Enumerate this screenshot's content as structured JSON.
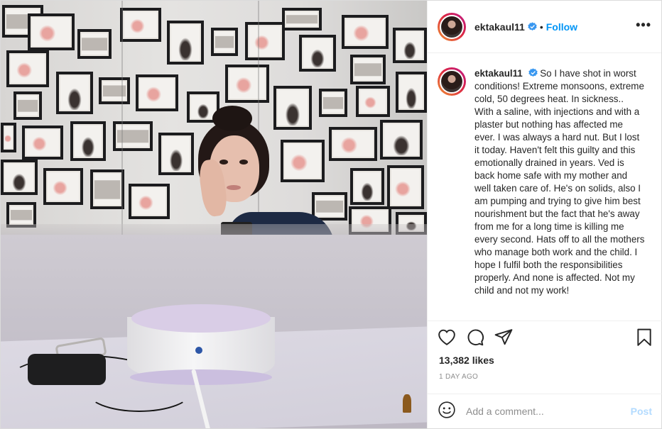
{
  "post": {
    "username": "ektakaul11",
    "separator": "•",
    "follow_label": "Follow",
    "more_label": "•••",
    "caption_username": "ektakaul11",
    "caption": "So I have shot in worst conditions! Extreme monsoons, extreme cold, 50 degrees heat. In sickness.. With a saline, with injections and with a plaster but nothing has affected me ever. I was always a hard nut. But I lost it today. Haven't felt this guilty and this emotionally drained in years. Ved is back home safe with my mother and well taken care of. He's on solids, also I am pumping and trying to give him best nourishment but the fact that he's away from me for a long time is killing me every second. Hats off to all the mothers who manage both work and the child. I hope I fulfil both the responsibilities properly. And none is affected. Not my child and not my work!",
    "likes": "13,382 likes",
    "timestamp": "1 DAY AGO"
  },
  "comment": {
    "placeholder": "Add a comment...",
    "post_label": "Post"
  },
  "icons": {
    "like": "heart-icon",
    "comment": "comment-icon",
    "share": "share-icon",
    "save": "bookmark-icon",
    "emoji": "emoji-icon",
    "verified": "verified-badge-icon"
  },
  "colors": {
    "follow": "#0095f6",
    "verified": "#3897f0",
    "post_disabled": "#b3dbff",
    "muted": "#8e8e8e"
  }
}
